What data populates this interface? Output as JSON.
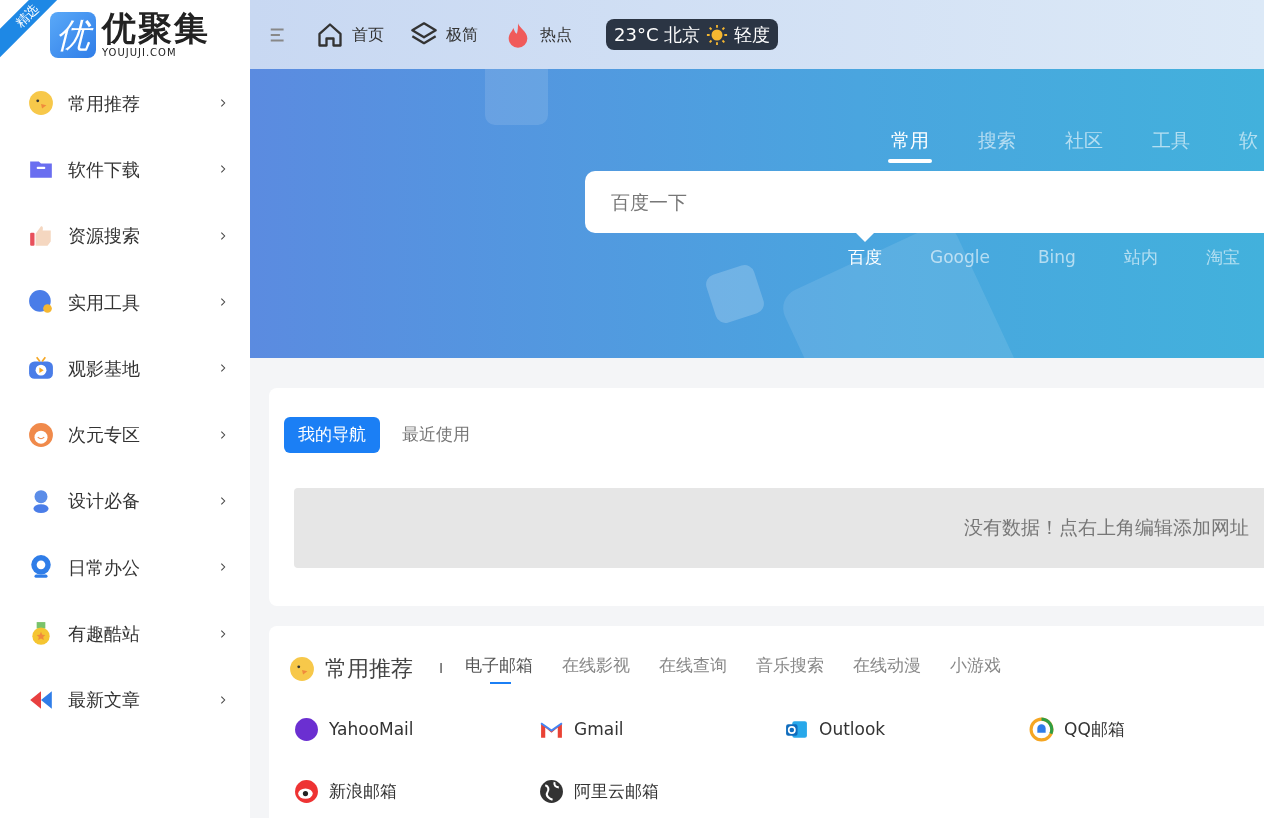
{
  "logo": {
    "ribbon": "精选",
    "mark": "优",
    "name": "优聚集",
    "domain": "YOUJUJI.COM"
  },
  "sidebar": {
    "items": [
      {
        "label": "常用推荐",
        "selected": false
      },
      {
        "label": "软件下载",
        "selected": false
      },
      {
        "label": "资源搜索",
        "selected": false
      },
      {
        "label": "实用工具",
        "selected": false
      },
      {
        "label": "观影基地",
        "selected": false
      },
      {
        "label": "次元专区",
        "selected": false
      },
      {
        "label": "设计必备",
        "selected": false
      },
      {
        "label": "日常办公",
        "selected": false
      },
      {
        "label": "有趣酷站",
        "selected": false
      },
      {
        "label": "最新文章",
        "selected": false
      }
    ]
  },
  "header": {
    "nav": [
      {
        "label": "首页",
        "kind": "home"
      },
      {
        "label": "极简",
        "kind": "layers"
      },
      {
        "label": "热点",
        "kind": "flame"
      }
    ],
    "weather": {
      "reading": "23°C 北京",
      "air": "轻度"
    }
  },
  "search": {
    "tabs": [
      {
        "label": "常用",
        "selected": true
      },
      {
        "label": "搜索",
        "selected": false
      },
      {
        "label": "社区",
        "selected": false
      },
      {
        "label": "工具",
        "selected": false
      },
      {
        "label": "软",
        "selected": false
      }
    ],
    "placeholder": "百度一下",
    "engines": [
      {
        "label": "百度",
        "selected": true
      },
      {
        "label": "Google",
        "selected": false
      },
      {
        "label": "Bing",
        "selected": false
      },
      {
        "label": "站内",
        "selected": false
      },
      {
        "label": "淘宝",
        "selected": false
      }
    ]
  },
  "my_nav": {
    "tabs": [
      {
        "label": "我的导航",
        "selected": true
      },
      {
        "label": "最近使用",
        "selected": false
      }
    ],
    "empty_message": "没有数据！点右上角编辑添加网址"
  },
  "recommend": {
    "title": "常用推荐",
    "separator": "I",
    "tabs": [
      {
        "label": "电子邮箱",
        "selected": true
      },
      {
        "label": "在线影视",
        "selected": false
      },
      {
        "label": "在线查询",
        "selected": false
      },
      {
        "label": "音乐搜索",
        "selected": false
      },
      {
        "label": "在线动漫",
        "selected": false
      },
      {
        "label": "小游戏",
        "selected": false
      }
    ],
    "links": [
      {
        "label": "YahooMail",
        "kind": "yahoo"
      },
      {
        "label": "Gmail",
        "kind": "gmail"
      },
      {
        "label": "Outlook",
        "kind": "outlook"
      },
      {
        "label": "QQ邮箱",
        "kind": "qq"
      },
      {
        "label": "新浪邮箱",
        "kind": "sina"
      },
      {
        "label": "阿里云邮箱",
        "kind": "aliyun"
      }
    ]
  }
}
